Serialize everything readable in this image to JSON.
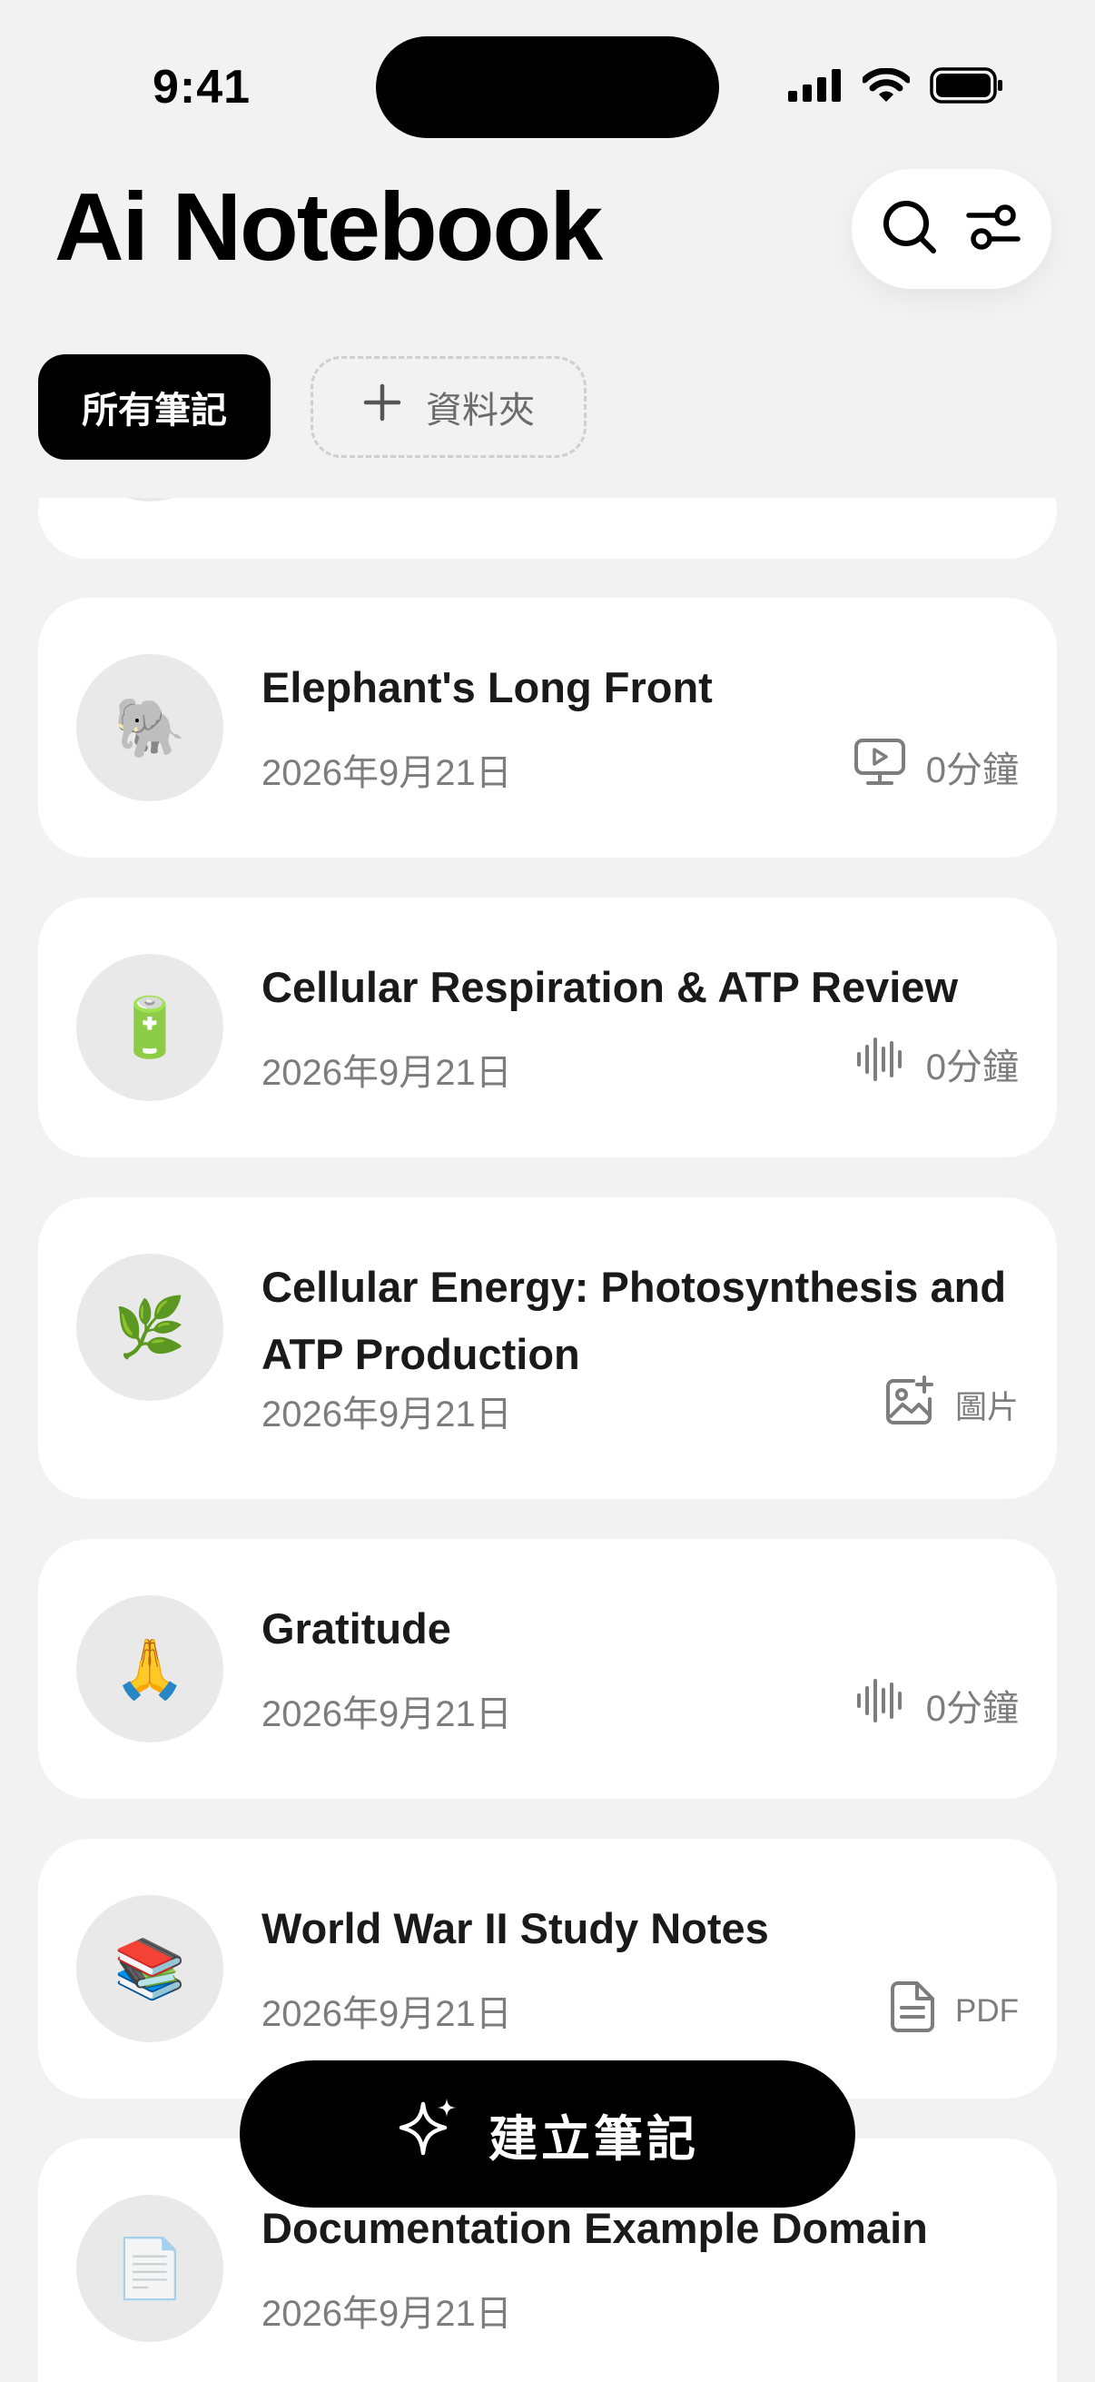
{
  "status_bar": {
    "time": "9:41"
  },
  "header": {
    "title": "Ai Notebook"
  },
  "tabs": {
    "all_notes": "所有筆記",
    "add_folder": "資料夾"
  },
  "notes": [
    {
      "title": "",
      "date": "",
      "icon": "",
      "meta": ""
    },
    {
      "title": "Elephant's Long Front",
      "date": "2026年9月21日",
      "icon": "🐘",
      "media": "video-icon",
      "meta": "0分鐘"
    },
    {
      "title": "Cellular Respiration & ATP Review",
      "date": "2026年9月21日",
      "icon": "🔋",
      "media": "audio-wave-icon",
      "meta": "0分鐘"
    },
    {
      "title": "Cellular Energy: Photosynthesis and ATP Production",
      "date": "2026年9月21日",
      "icon": "🌿",
      "media": "image-add-icon",
      "meta": "圖片"
    },
    {
      "title": "Gratitude",
      "date": "2026年9月21日",
      "icon": "🙏",
      "media": "audio-wave-icon",
      "meta": "0分鐘"
    },
    {
      "title": "World War II Study Notes",
      "date": "2026年9月21日",
      "icon": "📚",
      "media": "pdf-file-icon",
      "meta": "PDF"
    },
    {
      "title": "Documentation Example Domain",
      "date": "2026年9月21日",
      "icon": "📄",
      "media": "",
      "meta": ""
    }
  ],
  "fab": {
    "label": "建立筆記",
    "icon": "sparkle-icon"
  }
}
